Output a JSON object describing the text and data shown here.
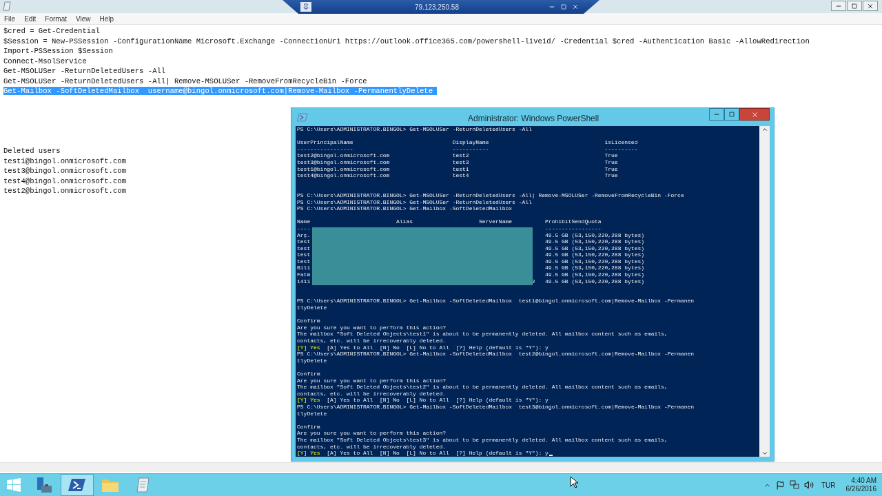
{
  "remote_bar": {
    "title": "79.123.250.58"
  },
  "notepad": {
    "menu": [
      "File",
      "Edit",
      "Format",
      "View",
      "Help"
    ],
    "lines": [
      {
        "kind": "text",
        "text": "$cred = Get-Credential",
        "selected": false
      },
      {
        "kind": "text",
        "text": "$Session = New-PSSession -ConfigurationName Microsoft.Exchange -ConnectionUri https://outlook.office365.com/powershell-liveid/ -Credential $cred -Authentication Basic -AllowRedirection",
        "selected": false
      },
      {
        "kind": "text",
        "text": "Import-PSSession $Session",
        "selected": false
      },
      {
        "kind": "text",
        "text": "Connect-MsolService",
        "selected": false
      },
      {
        "kind": "text",
        "text": "Get-MSOLUSer -ReturnDeletedUsers -All",
        "selected": false
      },
      {
        "kind": "text",
        "text": "Get-MSOLUSer -ReturnDeletedUsers -All| Remove-MSOLUSer -RemoveFromRecycleBin -Force",
        "selected": false
      },
      {
        "kind": "text",
        "text": "Get-Mailbox -SoftDeletedMailbox  username@bingol.onmicrosoft.com|Remove-Mailbox -PermanentlyDelete ",
        "selected": true
      },
      {
        "kind": "blank"
      },
      {
        "kind": "blank"
      },
      {
        "kind": "blank"
      },
      {
        "kind": "blank"
      },
      {
        "kind": "blank"
      },
      {
        "kind": "text",
        "text": "Deleted users",
        "selected": false
      },
      {
        "kind": "text",
        "text": "test1@bingol.onmicrosoft.com",
        "selected": false
      },
      {
        "kind": "text",
        "text": "test3@bingol.onmicrosoft.com",
        "selected": false
      },
      {
        "kind": "text",
        "text": "test4@bingol.onmicrosoft.com",
        "selected": false
      },
      {
        "kind": "text",
        "text": "test2@bingol.onmicrosoft.com",
        "selected": false
      }
    ]
  },
  "powershell": {
    "title": "Administrator: Windows PowerShell",
    "lines": [
      {
        "kind": "text",
        "text": "PS C:\\Users\\ADMINISTRATOR.BINGOL> Get-MSOLUSer -ReturnDeletedUsers -All"
      },
      {
        "kind": "blank"
      },
      {
        "kind": "user-row",
        "cells": [
          "UserPrincipalName",
          "DisplayName",
          "isLicensed"
        ]
      },
      {
        "kind": "user-row",
        "cells": [
          "-----------------",
          "-----------",
          "----------"
        ]
      },
      {
        "kind": "user-row",
        "cells": [
          "test2@bingol.onmicrosoft.com",
          "test2",
          "True"
        ]
      },
      {
        "kind": "user-row",
        "cells": [
          "test3@bingol.onmicrosoft.com",
          "test3",
          "True"
        ]
      },
      {
        "kind": "user-row",
        "cells": [
          "test1@bingol.onmicrosoft.com",
          "test1",
          "True"
        ]
      },
      {
        "kind": "user-row",
        "cells": [
          "test4@bingol.onmicrosoft.com",
          "test4",
          "True"
        ]
      },
      {
        "kind": "blank"
      },
      {
        "kind": "blank"
      },
      {
        "kind": "text",
        "text": "PS C:\\Users\\ADMINISTRATOR.BINGOL> Get-MSOLUSer -ReturnDeletedUsers -All| Remove-MSOLUSer -RemoveFromRecycleBin -Force"
      },
      {
        "kind": "text",
        "text": "PS C:\\Users\\ADMINISTRATOR.BINGOL> Get-MSOLUSer -ReturnDeletedUsers -All"
      },
      {
        "kind": "text",
        "text": "PS C:\\Users\\ADMINISTRATOR.BINGOL> Get-Mailbox -SoftDeletedMailbox"
      },
      {
        "kind": "blank"
      },
      {
        "kind": "mailbox-header",
        "cells": [
          "Name",
          "Alias",
          "ServerName",
          "ProhibitSendQuota"
        ]
      },
      {
        "kind": "mailbox-row",
        "name": "----",
        "quota": "-----------------"
      },
      {
        "kind": "mailbox-row",
        "name": "Arş.",
        "quota": "49.5 GB (53,150,220,288 bytes)"
      },
      {
        "kind": "mailbox-row",
        "name": "test",
        "quota": "49.5 GB (53,150,220,288 bytes)"
      },
      {
        "kind": "mailbox-row",
        "name": "test",
        "quota": "49.5 GB (53,150,220,288 bytes)"
      },
      {
        "kind": "mailbox-row",
        "name": "test",
        "quota": "49.5 GB (53,150,220,288 bytes)"
      },
      {
        "kind": "mailbox-row",
        "name": "test",
        "quota": "49.5 GB (53,150,220,288 bytes)"
      },
      {
        "kind": "mailbox-row",
        "name": "Bili",
        "quota": "49.5 GB (53,150,220,288 bytes)"
      },
      {
        "kind": "mailbox-row",
        "name": "Fatm",
        "quota": "49.5 GB (53,150,220,288 bytes)"
      },
      {
        "kind": "mailbox-row",
        "name": "1411",
        "tail": "2",
        "quota": "49.5 GB (53,150,220,288 bytes)"
      },
      {
        "kind": "blank"
      },
      {
        "kind": "blank"
      },
      {
        "kind": "text",
        "text": "PS C:\\Users\\ADMINISTRATOR.BINGOL> Get-Mailbox -SoftDeletedMailbox  test1@bingol.onmicrosoft.com|Remove-Mailbox -Permanen"
      },
      {
        "kind": "text",
        "text": "tlyDelete"
      },
      {
        "kind": "blank"
      },
      {
        "kind": "text",
        "text": "Confirm"
      },
      {
        "kind": "text",
        "text": "Are you sure you want to perform this action?"
      },
      {
        "kind": "text",
        "text": "The mailbox \"Soft Deleted Objects\\test1\" is about to be permanently deleted. All mailbox content such as emails,"
      },
      {
        "kind": "text",
        "text": "contacts, etc. will be irrecoverably deleted."
      },
      {
        "kind": "choice",
        "highlight": "[Y] Yes",
        "text": "  [A] Yes to All  [N] No  [L] No to All  [?] Help (default is \"Y\"): y"
      },
      {
        "kind": "text",
        "text": "PS C:\\Users\\ADMINISTRATOR.BINGOL> Get-Mailbox -SoftDeletedMailbox  test2@bingol.onmicrosoft.com|Remove-Mailbox -Permanen"
      },
      {
        "kind": "text",
        "text": "tlyDelete"
      },
      {
        "kind": "blank"
      },
      {
        "kind": "text",
        "text": "Confirm"
      },
      {
        "kind": "text",
        "text": "Are you sure you want to perform this action?"
      },
      {
        "kind": "text",
        "text": "The mailbox \"Soft Deleted Objects\\test2\" is about to be permanently deleted. All mailbox content such as emails,"
      },
      {
        "kind": "text",
        "text": "contacts, etc. will be irrecoverably deleted."
      },
      {
        "kind": "choice",
        "highlight": "[Y] Yes",
        "text": "  [A] Yes to All  [N] No  [L] No to All  [?] Help (default is \"Y\"): y"
      },
      {
        "kind": "text",
        "text": "PS C:\\Users\\ADMINISTRATOR.BINGOL> Get-Mailbox -SoftDeletedMailbox  test3@bingol.onmicrosoft.com|Remove-Mailbox -Permanen"
      },
      {
        "kind": "text",
        "text": "tlyDelete"
      },
      {
        "kind": "blank"
      },
      {
        "kind": "text",
        "text": "Confirm"
      },
      {
        "kind": "text",
        "text": "Are you sure you want to perform this action?"
      },
      {
        "kind": "text",
        "text": "The mailbox \"Soft Deleted Objects\\test3\" is about to be permanently deleted. All mailbox content such as emails,"
      },
      {
        "kind": "text",
        "text": "contacts, etc. will be irrecoverably deleted."
      },
      {
        "kind": "choice",
        "highlight": "[Y] Yes",
        "text": "  [A] Yes to All  [N] No  [L] No to All  [?] Help (default is \"Y\"): y"
      }
    ]
  },
  "taskbar": {
    "apps": [
      {
        "kind": "server-manager",
        "selected": false
      },
      {
        "kind": "powershell",
        "selected": true
      },
      {
        "kind": "explorer",
        "selected": false
      },
      {
        "kind": "notepad",
        "selected": false
      }
    ],
    "language": "TUR",
    "time": "4:40 AM",
    "date": "6/26/2016"
  }
}
